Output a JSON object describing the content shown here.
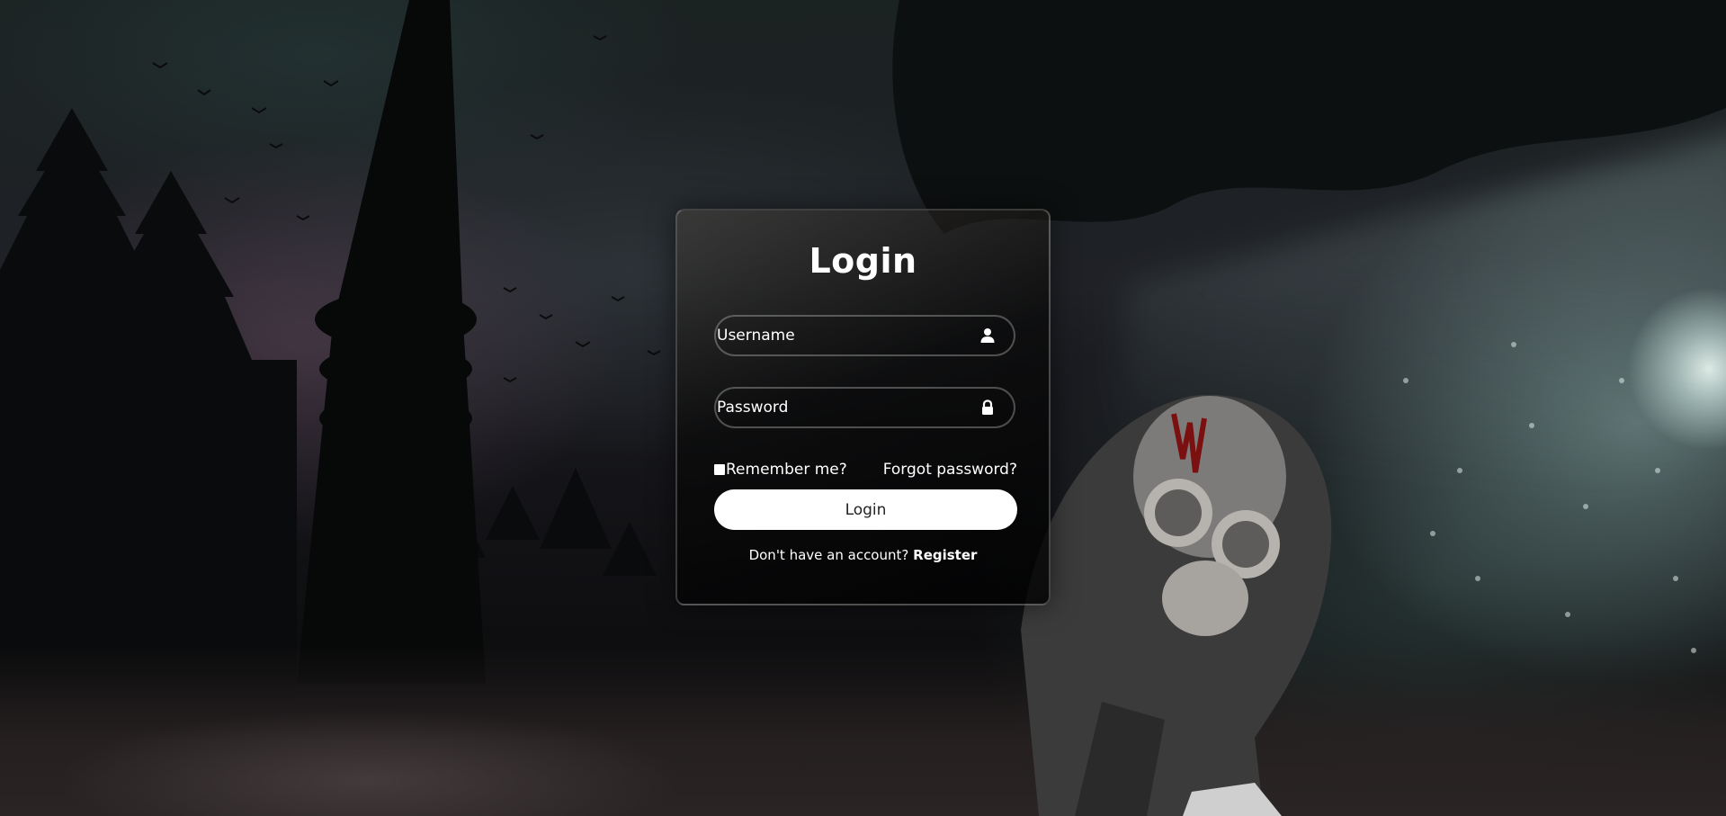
{
  "login_form": {
    "title": "Login",
    "username_placeholder": "Username",
    "password_placeholder": "Password",
    "remember_label": "Remember me?",
    "remember_checked": false,
    "forgot_label": "Forgot password?",
    "login_button_label": "Login",
    "register_prompt": "Don't have an account?",
    "register_label": "Register"
  },
  "icons": {
    "username": "user-icon",
    "password": "lock-icon"
  },
  "colors": {
    "button_bg": "#ffffff",
    "button_text": "#222222",
    "text": "#ffffff"
  }
}
